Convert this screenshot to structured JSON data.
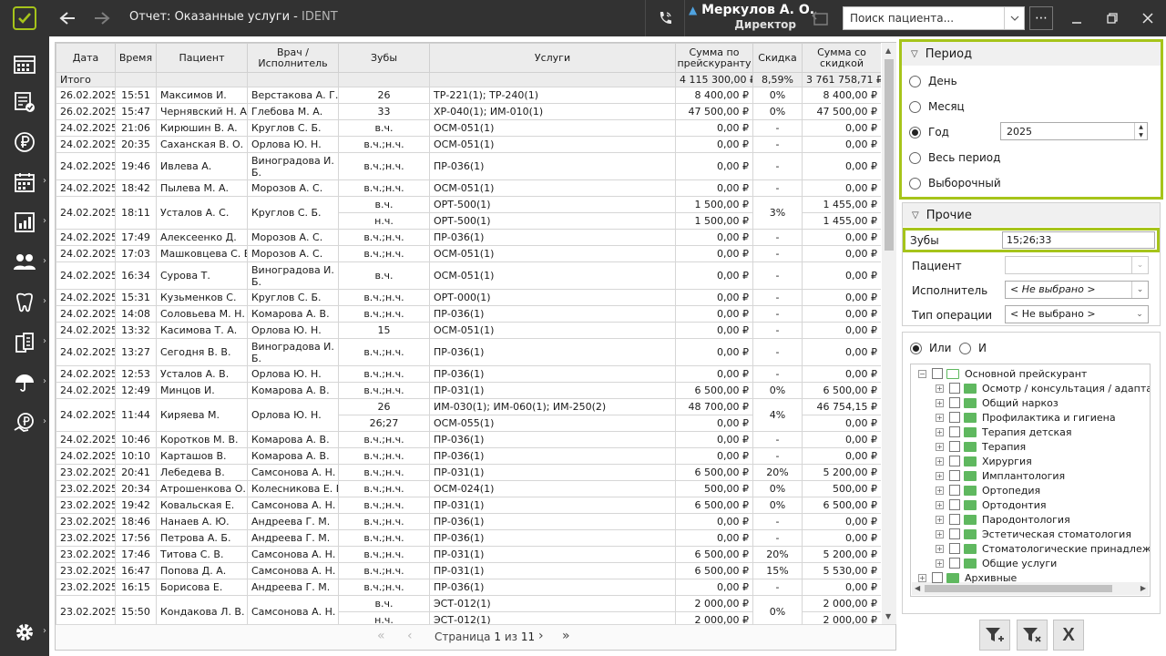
{
  "window": {
    "title": "Отчет: Оказанные услуги",
    "app_name": "IDENT",
    "user_name": "Меркулов А. О.",
    "user_role": "Директор",
    "search_placeholder": "Поиск пациента..."
  },
  "table": {
    "columns": [
      "Дата",
      "Время",
      "Пациент",
      "Врач / Исполнитель",
      "Зубы",
      "Услуги",
      "Сумма по прейскуранту",
      "Скидка",
      "Сумма со скидкой"
    ],
    "total": {
      "label": "Итого",
      "sum": "4 115 300,00 ₽",
      "discount": "8,59%",
      "discounted": "3 761 758,71 ₽"
    },
    "rows": [
      {
        "date": "26.02.2025",
        "time": "15:51",
        "patient": "Максимов И.",
        "doctor": "Верстакова А. Г.",
        "lines": [
          {
            "teeth": "26",
            "services": "ТР-221(1); ТР-240(1)",
            "sum": "8 400,00 ₽",
            "disc_sum": "8 400,00 ₽"
          }
        ],
        "discount": "0%"
      },
      {
        "date": "26.02.2025",
        "time": "15:47",
        "patient": "Чернявский Н. А.",
        "doctor": "Глебова М. А.",
        "lines": [
          {
            "teeth": "33",
            "services": "ХР-040(1); ИМ-010(1)",
            "sum": "47 500,00 ₽",
            "disc_sum": "47 500,00 ₽"
          }
        ],
        "discount": "0%"
      },
      {
        "date": "24.02.2025",
        "time": "21:06",
        "patient": "Кирюшин В. А.",
        "doctor": "Круглов С. Б.",
        "lines": [
          {
            "teeth": "в.ч.",
            "services": "ОСМ-051(1)",
            "sum": "0,00 ₽",
            "disc_sum": "0,00 ₽"
          }
        ],
        "discount": "-"
      },
      {
        "date": "24.02.2025",
        "time": "20:35",
        "patient": "Саханская В. О.",
        "doctor": "Орлова Ю. Н.",
        "lines": [
          {
            "teeth": "в.ч.;н.ч.",
            "services": "ОСМ-051(1)",
            "sum": "0,00 ₽",
            "disc_sum": "0,00 ₽"
          }
        ],
        "discount": "-"
      },
      {
        "date": "24.02.2025",
        "time": "19:46",
        "patient": "Ивлева А.",
        "doctor": "Виноградова И. Б.",
        "tall": true,
        "lines": [
          {
            "teeth": "в.ч.;н.ч.",
            "services": "ПР-036(1)",
            "sum": "0,00 ₽",
            "disc_sum": "0,00 ₽"
          }
        ],
        "discount": "-"
      },
      {
        "date": "24.02.2025",
        "time": "18:42",
        "patient": "Пылева М. А.",
        "doctor": "Морозов А. С.",
        "lines": [
          {
            "teeth": "в.ч.;н.ч.",
            "services": "ОСМ-051(1)",
            "sum": "0,00 ₽",
            "disc_sum": "0,00 ₽"
          }
        ],
        "discount": "-"
      },
      {
        "date": "24.02.2025",
        "time": "18:11",
        "patient": "Усталов А. С.",
        "doctor": "Круглов С. Б.",
        "lines": [
          {
            "teeth": "в.ч.",
            "services": "ОРТ-500(1)",
            "sum": "1 500,00 ₽",
            "disc_sum": "1 455,00 ₽"
          },
          {
            "teeth": "н.ч.",
            "services": "ОРТ-500(1)",
            "sum": "1 500,00 ₽",
            "disc_sum": "1 455,00 ₽"
          }
        ],
        "discount": "3%"
      },
      {
        "date": "24.02.2025",
        "time": "17:49",
        "patient": "Алексеенко Д.",
        "doctor": "Морозов А. С.",
        "lines": [
          {
            "teeth": "в.ч.;н.ч.",
            "services": "ПР-036(1)",
            "sum": "0,00 ₽",
            "disc_sum": "0,00 ₽"
          }
        ],
        "discount": "-"
      },
      {
        "date": "24.02.2025",
        "time": "17:03",
        "patient": "Машковцева С. В.",
        "doctor": "Морозов А. С.",
        "lines": [
          {
            "teeth": "в.ч.;н.ч.",
            "services": "ОСМ-051(1)",
            "sum": "0,00 ₽",
            "disc_sum": "0,00 ₽"
          }
        ],
        "discount": "-"
      },
      {
        "date": "24.02.2025",
        "time": "16:34",
        "patient": "Сурова Т.",
        "doctor": "Виноградова И. Б.",
        "tall": true,
        "lines": [
          {
            "teeth": "в.ч.",
            "services": "ОСМ-051(1)",
            "sum": "0,00 ₽",
            "disc_sum": "0,00 ₽"
          }
        ],
        "discount": "-"
      },
      {
        "date": "24.02.2025",
        "time": "15:31",
        "patient": "Кузьменков С.",
        "doctor": "Круглов С. Б.",
        "lines": [
          {
            "teeth": "в.ч.;н.ч.",
            "services": "ОРТ-000(1)",
            "sum": "0,00 ₽",
            "disc_sum": "0,00 ₽"
          }
        ],
        "discount": "-"
      },
      {
        "date": "24.02.2025",
        "time": "14:08",
        "patient": "Соловьева М. Н.",
        "doctor": "Комарова А. В.",
        "lines": [
          {
            "teeth": "в.ч.;н.ч.",
            "services": "ПР-036(1)",
            "sum": "0,00 ₽",
            "disc_sum": "0,00 ₽"
          }
        ],
        "discount": "-"
      },
      {
        "date": "24.02.2025",
        "time": "13:32",
        "patient": "Касимова Т. А.",
        "doctor": "Орлова Ю. Н.",
        "lines": [
          {
            "teeth": "15",
            "services": "ОСМ-051(1)",
            "sum": "0,00 ₽",
            "disc_sum": "0,00 ₽"
          }
        ],
        "discount": "-"
      },
      {
        "date": "24.02.2025",
        "time": "13:27",
        "patient": "Сегодня В. В.",
        "doctor": "Виноградова И. Б.",
        "tall": true,
        "lines": [
          {
            "teeth": "в.ч.;н.ч.",
            "services": "ПР-036(1)",
            "sum": "0,00 ₽",
            "disc_sum": "0,00 ₽"
          }
        ],
        "discount": "-"
      },
      {
        "date": "24.02.2025",
        "time": "12:53",
        "patient": "Усталов А. В.",
        "doctor": "Орлова Ю. Н.",
        "lines": [
          {
            "teeth": "в.ч.;н.ч.",
            "services": "ПР-036(1)",
            "sum": "0,00 ₽",
            "disc_sum": "0,00 ₽"
          }
        ],
        "discount": "-"
      },
      {
        "date": "24.02.2025",
        "time": "12:49",
        "patient": "Минцов И.",
        "doctor": "Комарова А. В.",
        "lines": [
          {
            "teeth": "в.ч.;н.ч.",
            "services": "ПР-031(1)",
            "sum": "6 500,00 ₽",
            "disc_sum": "6 500,00 ₽"
          }
        ],
        "discount": "0%"
      },
      {
        "date": "24.02.2025",
        "time": "11:44",
        "patient": "Киряева М.",
        "doctor": "Орлова Ю. Н.",
        "lines": [
          {
            "teeth": "26",
            "services": "ИМ-030(1); ИМ-060(1); ИМ-250(2)",
            "sum": "48 700,00 ₽",
            "disc_sum": "46 754,15 ₽"
          },
          {
            "teeth": "26;27",
            "services": "ОСМ-055(1)",
            "sum": "0,00 ₽",
            "disc_sum": "0,00 ₽"
          }
        ],
        "discount": "4%"
      },
      {
        "date": "24.02.2025",
        "time": "10:46",
        "patient": "Коротков М. В.",
        "doctor": "Комарова А. В.",
        "lines": [
          {
            "teeth": "в.ч.;н.ч.",
            "services": "ПР-036(1)",
            "sum": "0,00 ₽",
            "disc_sum": "0,00 ₽"
          }
        ],
        "discount": "-"
      },
      {
        "date": "24.02.2025",
        "time": "10:10",
        "patient": "Карташов В.",
        "doctor": "Комарова А. В.",
        "lines": [
          {
            "teeth": "в.ч.;н.ч.",
            "services": "ПР-036(1)",
            "sum": "0,00 ₽",
            "disc_sum": "0,00 ₽"
          }
        ],
        "discount": "-"
      },
      {
        "date": "23.02.2025",
        "time": "20:41",
        "patient": "Лебедева В.",
        "doctor": "Самсонова А. Н.",
        "lines": [
          {
            "teeth": "в.ч.;н.ч.",
            "services": "ПР-031(1)",
            "sum": "6 500,00 ₽",
            "disc_sum": "5 200,00 ₽"
          }
        ],
        "discount": "20%"
      },
      {
        "date": "23.02.2025",
        "time": "20:34",
        "patient": "Атрошенкова О. С.",
        "doctor": "Колесникова Е. В.",
        "lines": [
          {
            "teeth": "в.ч.;н.ч.",
            "services": "ОСМ-024(1)",
            "sum": "500,00 ₽",
            "disc_sum": "500,00 ₽"
          }
        ],
        "discount": "0%"
      },
      {
        "date": "23.02.2025",
        "time": "19:42",
        "patient": "Ковальская Е.",
        "doctor": "Самсонова А. Н.",
        "lines": [
          {
            "teeth": "в.ч.;н.ч.",
            "services": "ПР-031(1)",
            "sum": "6 500,00 ₽",
            "disc_sum": "6 500,00 ₽"
          }
        ],
        "discount": "0%"
      },
      {
        "date": "23.02.2025",
        "time": "18:46",
        "patient": "Нанаев А. Ю.",
        "doctor": "Андреева Г. М.",
        "lines": [
          {
            "teeth": "в.ч.;н.ч.",
            "services": "ПР-036(1)",
            "sum": "0,00 ₽",
            "disc_sum": "0,00 ₽"
          }
        ],
        "discount": "-"
      },
      {
        "date": "23.02.2025",
        "time": "17:56",
        "patient": "Петрова А. Б.",
        "doctor": "Андреева Г. М.",
        "lines": [
          {
            "teeth": "в.ч.;н.ч.",
            "services": "ПР-036(1)",
            "sum": "0,00 ₽",
            "disc_sum": "0,00 ₽"
          }
        ],
        "discount": "-"
      },
      {
        "date": "23.02.2025",
        "time": "17:46",
        "patient": "Титова С. В.",
        "doctor": "Самсонова А. Н.",
        "lines": [
          {
            "teeth": "в.ч.;н.ч.",
            "services": "ПР-031(1)",
            "sum": "6 500,00 ₽",
            "disc_sum": "5 200,00 ₽"
          }
        ],
        "discount": "20%"
      },
      {
        "date": "23.02.2025",
        "time": "16:47",
        "patient": "Попова Д. А.",
        "doctor": "Самсонова А. Н.",
        "lines": [
          {
            "teeth": "в.ч.;н.ч.",
            "services": "ПР-031(1)",
            "sum": "6 500,00 ₽",
            "disc_sum": "5 530,00 ₽"
          }
        ],
        "discount": "15%"
      },
      {
        "date": "23.02.2025",
        "time": "16:15",
        "patient": "Борисова Е.",
        "doctor": "Андреева Г. М.",
        "lines": [
          {
            "teeth": "в.ч.;н.ч.",
            "services": "ПР-036(1)",
            "sum": "0,00 ₽",
            "disc_sum": "0,00 ₽"
          }
        ],
        "discount": "-"
      },
      {
        "date": "23.02.2025",
        "time": "15:50",
        "patient": "Кондакова Л. В.",
        "doctor": "Самсонова А. Н.",
        "lines": [
          {
            "teeth": "в.ч.",
            "services": "ЭСТ-012(1)",
            "sum": "2 000,00 ₽",
            "disc_sum": "2 000,00 ₽"
          },
          {
            "teeth": "н.ч.",
            "services": "ЭСТ-012(1)",
            "sum": "2 000,00 ₽",
            "disc_sum": "2 000,00 ₽"
          }
        ],
        "discount": "0%"
      }
    ]
  },
  "pager": {
    "page_label": "Страница",
    "current": "1",
    "of_label": "из",
    "total": "11"
  },
  "period": {
    "title": "Период",
    "options": [
      "День",
      "Месяц",
      "Год",
      "Весь период",
      "Выборочный"
    ],
    "selected": "Год",
    "year": "2025"
  },
  "other": {
    "title": "Прочие",
    "teeth_label": "Зубы",
    "teeth_value": "15;26;33",
    "patient_label": "Пациент",
    "patient_value": "",
    "performer_label": "Исполнитель",
    "performer_value": "< Не выбрано >",
    "op_type_label": "Тип операции",
    "op_type_value": "< Не выбрано >"
  },
  "logic": {
    "or_label": "Или",
    "and_label": "И",
    "selected": "Или"
  },
  "tree": {
    "root": "Основной прейскурант",
    "children": [
      "Осмотр / консультация / адаптация",
      "Общий наркоз",
      "Профилактика и гигиена",
      "Терапия детская",
      "Терапия",
      "Хирургия",
      "Имплантология",
      "Ортопедия",
      "Ортодонтия",
      "Пародонтология",
      "Эстетическая стоматология",
      "Стоматологические принадлежности",
      "Общие услуги"
    ],
    "archive": "Архивные"
  },
  "colors": {
    "accent": "#a6c41a",
    "chrome": "#323232",
    "folder": "#5fb85f"
  }
}
